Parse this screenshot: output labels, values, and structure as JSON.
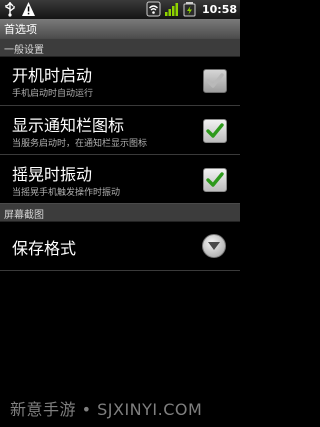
{
  "status_bar": {
    "left_icons": [
      "usb-icon",
      "warning-icon"
    ],
    "right_icons": [
      "wifi-icon",
      "signal-icon",
      "battery-icon"
    ],
    "time": "10:58"
  },
  "title_bar": {
    "title": "首选项"
  },
  "sections": [
    {
      "header": "一般设置",
      "items": [
        {
          "title": "开机时启动",
          "summary": "手机启动时自动运行",
          "checked": true,
          "enabled": false
        },
        {
          "title": "显示通知栏图标",
          "summary": "当服务启动时，在通知栏显示图标",
          "checked": true,
          "enabled": true
        },
        {
          "title": "摇晃时振动",
          "summary": "当摇晃手机触发操作时振动",
          "checked": true,
          "enabled": true
        }
      ]
    },
    {
      "header": "屏幕截图",
      "items": [
        {
          "title": "保存格式",
          "control": "dropdown"
        }
      ]
    }
  ],
  "watermark": "新意手游 • SJXINYI.COM",
  "colors": {
    "check_mark": "#2e9a1c",
    "check_mark_disabled": "#b9b9b9"
  }
}
